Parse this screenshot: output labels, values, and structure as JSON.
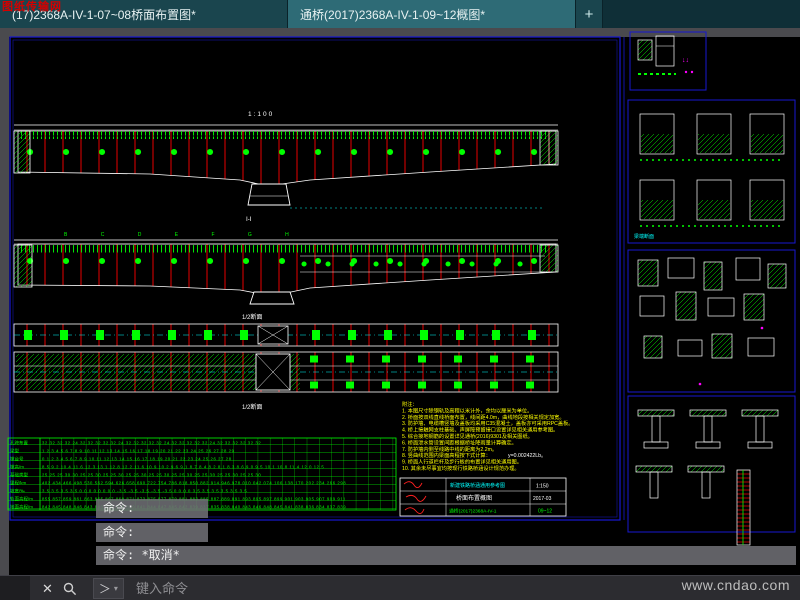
{
  "tabs": {
    "tab1": "(17)2368A-IV-1-07~08桥面布置图*",
    "tab2": "通桥(2017)2368A-IV-1-09~12概图*",
    "new_tab": "+"
  },
  "watermarks": {
    "corner": "图纸传输网",
    "site": "www.cndao.com"
  },
  "command": {
    "history": [
      "命令:",
      "命令:",
      "命令: *取消*"
    ],
    "prompt": "＞",
    "caret": "▾",
    "close_glyph": "✕",
    "input_placeholder": "键入命令"
  },
  "drawing": {
    "labels": {
      "scale_top": "1:100",
      "section_mid": "Ⅰ-Ⅰ",
      "half1": "1/2断面",
      "half2": "1/2断面",
      "letters": "B C D E F G H"
    },
    "formula": "y=0.002422Lb。"
  },
  "notes": [
    "附注：",
    "1. 本图尺寸除钢轨及高程以米计外，余均以厘米为单位。",
    "2. 桥面按双线直线桥面布置，线间距4.0m，曲线地段按相关规定加宽。",
    "3. 防护墙、电缆槽竖墙及盖板均采用C35混凝土，盖板亦可采用RPC盖板。",
    "4. 桥上接触网支柱基础、声屏障预留接口设置详见相关通用参考图。",
    "5. 综合接地钢筋的设置详见通桥(2016)9301及相关图纸。",
    "6. 桥面泄水管设置间距根据桥址降雨量计算确定。",
    "7. 防护墙内侧至线路中线的距离为2.2m。",
    "8. 竖曲线范围内梁面高程按下式计算：",
    "9. 桥面人行道栏杆及步行板的布置详见相关通用图。",
    "10. 其余未尽事宜均按现行铁路桥涵设计规范办理。"
  ],
  "table": {
    "row_labels": [
      "孔跨布置",
      "梁型",
      "墩台号",
      "墩高/m",
      "基础类型",
      "里程/km",
      "坡度/‰",
      "轨面高程/m",
      "地面高程/m"
    ],
    "rows": [
      "32 32 32 32 24 32 32 32 32 32 24 32 32 32 32 32 24 32 32 32 32 32 24 32 32 32 32 32 32",
      "1 2 3 4 5 6 7 8 9 10 11 12 13 14 15 16 17 18 19 20 21 22 23 24 25 26 27 28 29",
      "0 1 2 3 4 5 6 7 8 9 10 11 12 13 14 15 16 17 18 19 20 21 22 23 24 25 26 27 28",
      "8.5 9.2 10.4 11.6 12.3 13.1 12.8 12.2 11.6 10.9 10.2 9.6 9.1 8.7 8.4 8.2 8.1 8.3 8.6 9.0 9.5 10.1 10.8 11.4 12.0 12.5",
      "25 25 25 30 30 25 25 30 25 25 30 25 25 30 25 25 30 25 25 30 25 25 30 25 25 30 25 25 30",
      "402 434 466 498 530 562 594 626 658 690 722 754 786 818 850 882 914 946 978 010 042 074 106 138 170 202 234 266 298",
      "3.5 3.5 3.5 3.5 0 0 0 0 0 0 0 0 -3.5 -3.5 -3.5 -3.5 -3.5 0 0 0 0 3.5 3.5 3.5 3.5 3.5 3.5",
      "855 857 859 861 863 865 867 869 871 873 875 877 879 881 883 885 887 889 891 893 895 897 899 901 903 905 907 909 911",
      "842 845 848 846 843 840 838 836 839 841 844 847 845 842 839 837 835 838 840 843 846 848 845 841 838 836 834 837 839"
    ]
  },
  "title_block": {
    "project": "新建铁路桥涵通用参考图",
    "title": "桥面布置概图",
    "number": "通桥(2017)2368A-IV-1",
    "sheet": "09~12",
    "scale": "1:150",
    "date": "2017-03"
  },
  "panels": {
    "p1_caption": "梁端断面",
    "magenta_marks": "↓↓"
  },
  "colors": {
    "cad_green": "#00ff00",
    "cad_red": "#e60000",
    "cad_cyan": "#00ffff",
    "cad_yellow": "#ffff00",
    "cad_blue": "#1717d1",
    "cad_magenta": "#ff00ff",
    "tab_active": "#2e6b76"
  }
}
